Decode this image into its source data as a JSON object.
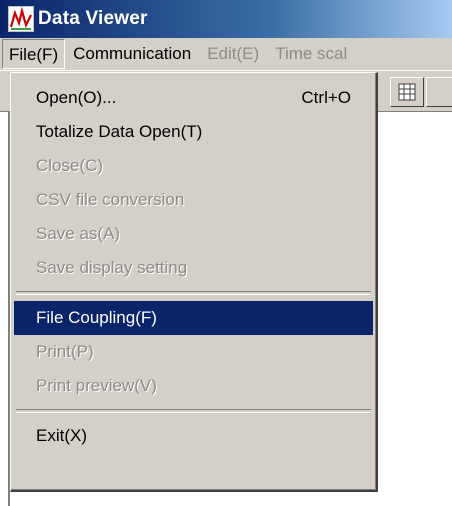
{
  "window": {
    "title": "Data Viewer",
    "icon": "chart-line-icon"
  },
  "menubar": {
    "items": [
      {
        "label": "File(F)",
        "state": "active"
      },
      {
        "label": "Communication",
        "state": "enabled"
      },
      {
        "label": "Edit(E)",
        "state": "disabled"
      },
      {
        "label": "Time scal",
        "state": "disabled"
      }
    ]
  },
  "file_menu": {
    "items": [
      {
        "label": "Open(O)...",
        "shortcut": "Ctrl+O",
        "enabled": true
      },
      {
        "label": "Totalize Data Open(T)",
        "enabled": true
      },
      {
        "label": "Close(C)",
        "enabled": false
      },
      {
        "label": "CSV file conversion",
        "enabled": false
      },
      {
        "label": "Save as(A)",
        "enabled": false
      },
      {
        "label": "Save display setting",
        "enabled": false
      },
      {
        "label": "File Coupling(F)",
        "enabled": true,
        "highlighted": true
      },
      {
        "label": "Print(P)",
        "enabled": false
      },
      {
        "label": "Print preview(V)",
        "enabled": false
      },
      {
        "label": "Exit(X)",
        "enabled": true
      }
    ]
  },
  "colors": {
    "title_bar": "#0a246a",
    "menu_face": "#d4d0c8",
    "highlight": "#0a246a",
    "disabled_text": "#8e8c88"
  }
}
